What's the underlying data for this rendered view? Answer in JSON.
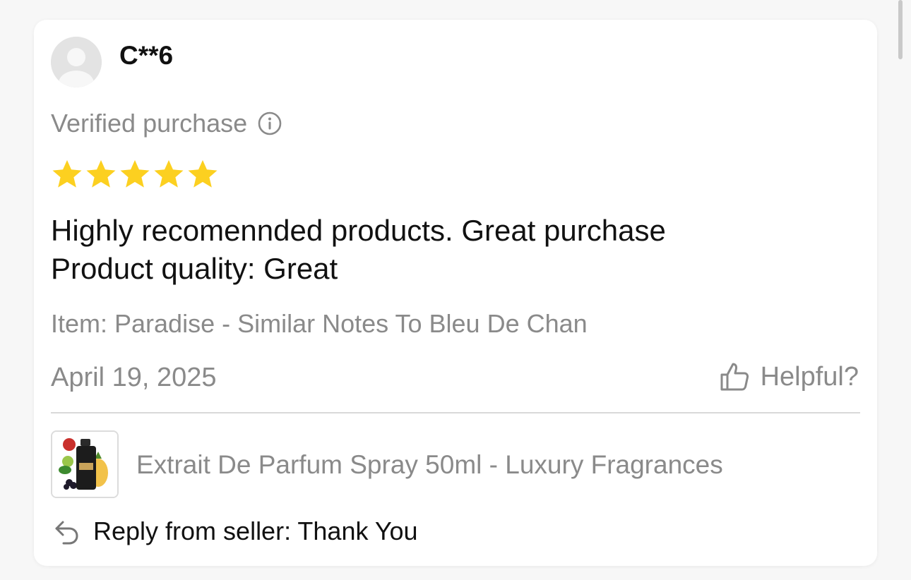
{
  "review": {
    "username": "C**6",
    "verified_label": "Verified purchase",
    "rating": 5,
    "rating_max": 5,
    "text_lines": [
      "Highly recomennded products. Great purchase",
      "Product quality: Great"
    ],
    "item": "Item: Paradise - Similar Notes To Bleu De Chan",
    "date": "April 19, 2025",
    "helpful_label": "Helpful?"
  },
  "product": {
    "title": "Extrait De Parfum Spray 50ml - Luxury Fragrances"
  },
  "seller_reply": {
    "text": "Reply from seller: Thank You"
  },
  "icons": {
    "avatar": "avatar-placeholder-icon",
    "info": "info-circle-icon",
    "star": "star-icon",
    "helpful": "thumbs-up-icon",
    "reply": "reply-arrow-icon"
  },
  "colors": {
    "star": "#fcd020",
    "muted_text": "#8a8a8a",
    "primary_text": "#111111",
    "card_background": "#ffffff",
    "page_background": "#f7f7f7"
  }
}
